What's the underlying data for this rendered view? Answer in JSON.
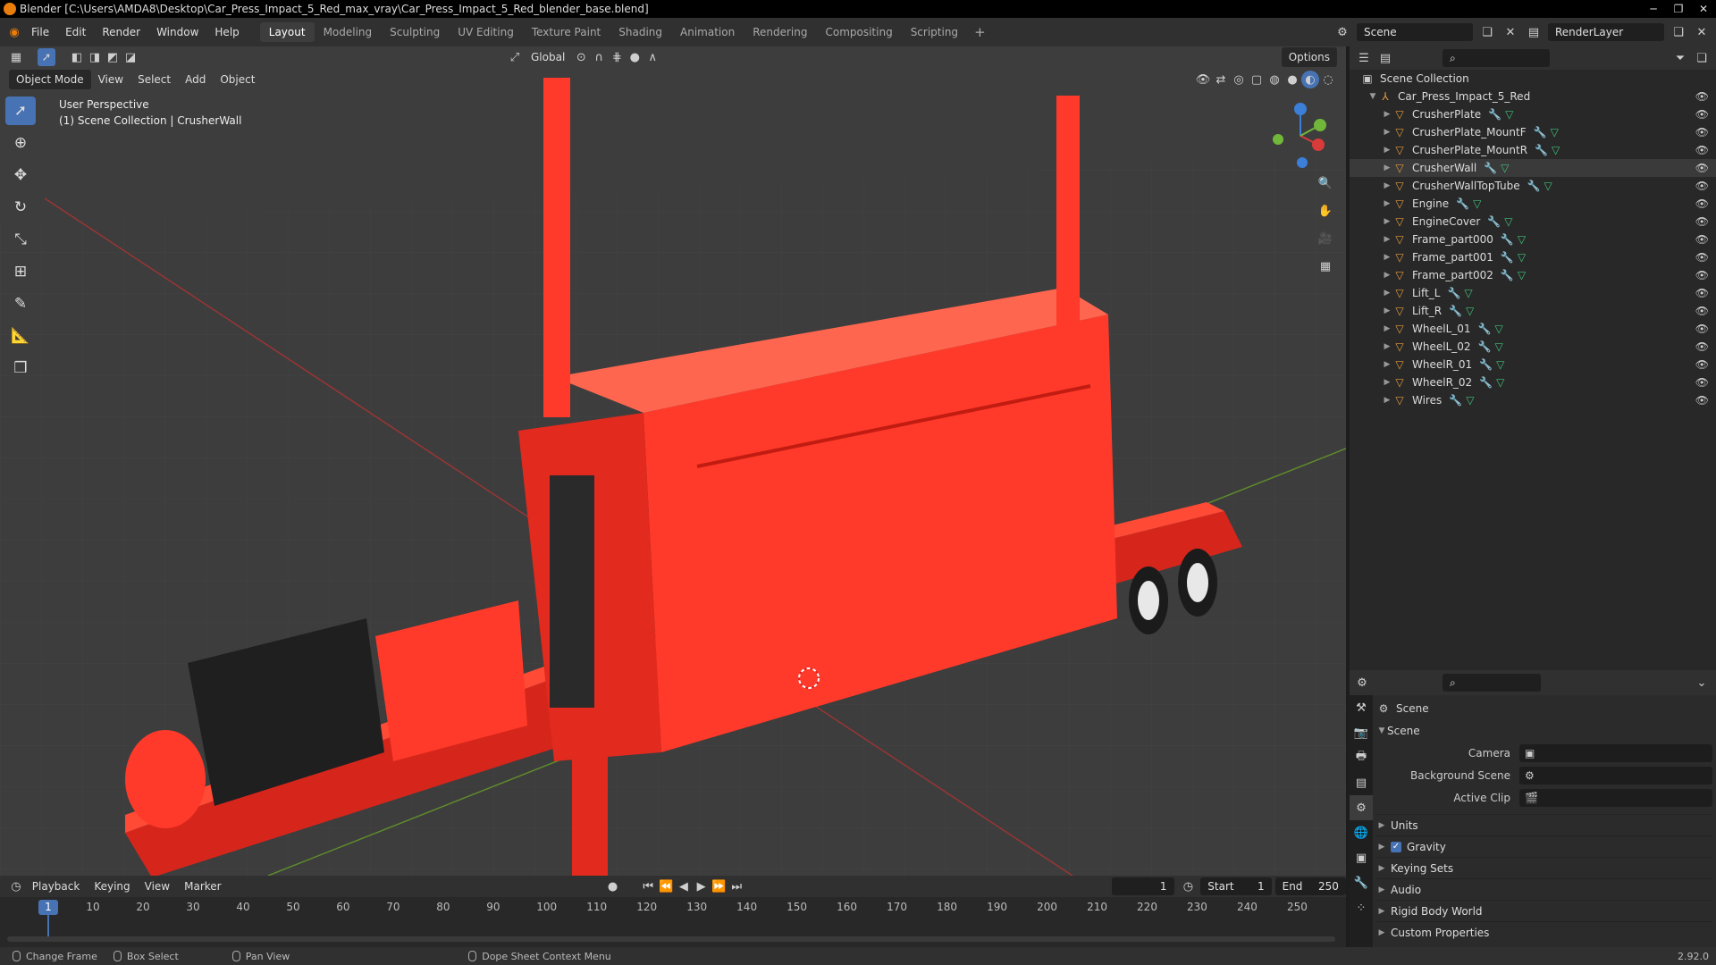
{
  "titlebar": {
    "title": "Blender [C:\\Users\\AMDA8\\Desktop\\Car_Press_Impact_5_Red_max_vray\\Car_Press_Impact_5_Red_blender_base.blend]"
  },
  "menus": [
    "File",
    "Edit",
    "Render",
    "Window",
    "Help"
  ],
  "workspaces": [
    "Layout",
    "Modeling",
    "Sculpting",
    "UV Editing",
    "Texture Paint",
    "Shading",
    "Animation",
    "Rendering",
    "Compositing",
    "Scripting"
  ],
  "scene_field": "Scene",
  "renderlayer_field": "RenderLayer",
  "viewport": {
    "orientation": "Global",
    "options": "Options",
    "mode": "Object Mode",
    "menu": [
      "View",
      "Select",
      "Add",
      "Object"
    ],
    "info_line1": "User Perspective",
    "info_line2": "(1) Scene Collection | CrusherWall"
  },
  "outliner": {
    "root": "Scene Collection",
    "collection": "Car_Press_Impact_5_Red",
    "items": [
      "CrusherPlate",
      "CrusherPlate_MountF",
      "CrusherPlate_MountR",
      "CrusherWall",
      "CrusherWallTopTube",
      "Engine",
      "EngineCover",
      "Frame_part000",
      "Frame_part001",
      "Frame_part002",
      "Lift_L",
      "Lift_R",
      "WheelL_01",
      "WheelL_02",
      "WheelR_01",
      "WheelR_02",
      "Wires"
    ],
    "selected": "CrusherWall"
  },
  "properties": {
    "header": "Scene",
    "section": "Scene",
    "camera_label": "Camera",
    "bg_label": "Background Scene",
    "clip_label": "Active Clip",
    "panels": [
      "Units",
      "Gravity",
      "Keying Sets",
      "Audio",
      "Rigid Body World",
      "Custom Properties"
    ]
  },
  "timeline": {
    "menus": [
      "Playback",
      "Keying",
      "View",
      "Marker"
    ],
    "current_frame": "1",
    "start_label": "Start",
    "start": "1",
    "end_label": "End",
    "end": "250",
    "ticks": [
      "1",
      "10",
      "20",
      "30",
      "40",
      "50",
      "60",
      "70",
      "80",
      "90",
      "100",
      "110",
      "120",
      "130",
      "140",
      "150",
      "160",
      "170",
      "180",
      "190",
      "200",
      "210",
      "220",
      "230",
      "240",
      "250"
    ]
  },
  "status": {
    "items": [
      "Change Frame",
      "Box Select",
      "Pan View",
      "Dope Sheet Context Menu"
    ],
    "version": "2.92.0"
  },
  "colors": {
    "accent": "#4772b3",
    "model_red": "#ff3a2a"
  }
}
